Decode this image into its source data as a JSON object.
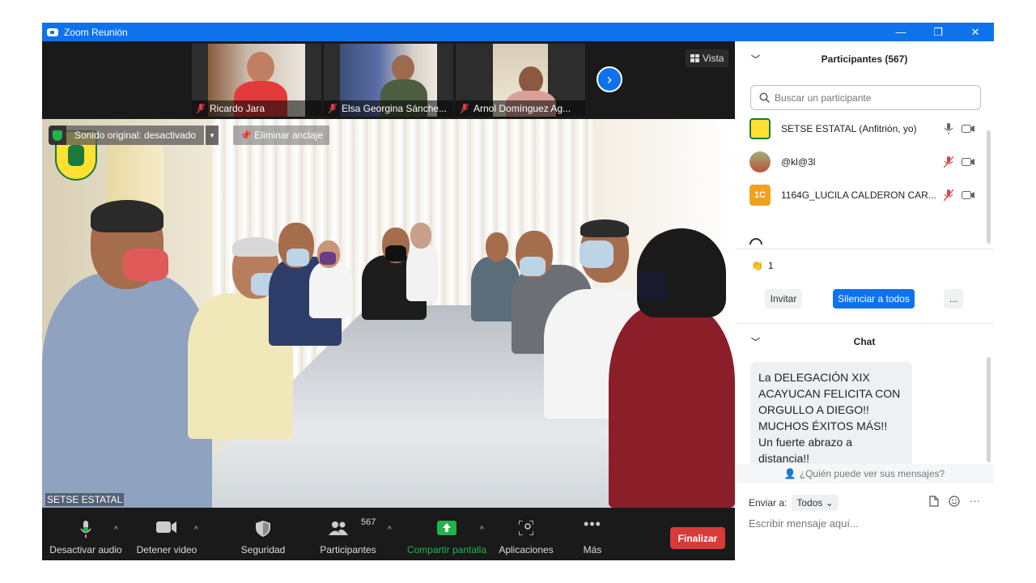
{
  "window": {
    "title": "Zoom Reunión",
    "controls": {
      "minimize": "—",
      "restore": "❐",
      "close": "✕"
    }
  },
  "gallery_strip": {
    "thumbnails": [
      {
        "name": "Ricardo Jara",
        "muted": true
      },
      {
        "name": "Elsa Georgina Sánche...",
        "muted": true
      },
      {
        "name": "Arnol Domínguez Ag...",
        "muted": true
      }
    ],
    "next_icon": "chevron-right-icon",
    "view_label": "Vista"
  },
  "main_video": {
    "original_sound_label": "Sonido original: desactivado",
    "unpin_label": "Eliminar anclaje",
    "speaker_name": "SETSE ESTATAL"
  },
  "toolbar": {
    "mute_label": "Desactivar audio",
    "video_label": "Detener video",
    "security_label": "Seguridad",
    "participants_label": "Participantes",
    "participants_count": "567",
    "share_label": "Compartir pantalla",
    "apps_label": "Aplicaciones",
    "more_label": "Más",
    "end_label": "Finalizar",
    "accent_green": "#24b24a",
    "end_color": "#d83a3a"
  },
  "participants_panel": {
    "title": "Participantes (567)",
    "search_placeholder": "Buscar un participante",
    "participants": [
      {
        "name": "SETSE ESTATAL (Anfitrión, yo)",
        "muted": false
      },
      {
        "name": "@kl@3l",
        "muted": true
      },
      {
        "name": "1164G_LUCILA CALDERON CAR...",
        "initials": "1C",
        "muted": true
      }
    ],
    "reaction_count": "1",
    "invite_label": "Invitar",
    "mute_all_label": "Silenciar a todos",
    "more_label": "..."
  },
  "chat_panel": {
    "title": "Chat",
    "message": "La DELEGACIÓN XIX ACAYUCAN FELICITA CON ORGULLO A DIEGO!! MUCHOS ÉXITOS MÁS!! Un fuerte abrazo a distancia!!",
    "who_can_see": "¿Quién puede ver sus mensajes?",
    "send_to_label": "Enviar a:",
    "send_to_value": "Todos",
    "input_placeholder": "Escribir mensaje aquí...",
    "more_icon": "···"
  },
  "colors": {
    "title_bar": "#0e72ed",
    "primary_button": "#0e72ed",
    "toolbar_bg": "#1a1a1a"
  }
}
